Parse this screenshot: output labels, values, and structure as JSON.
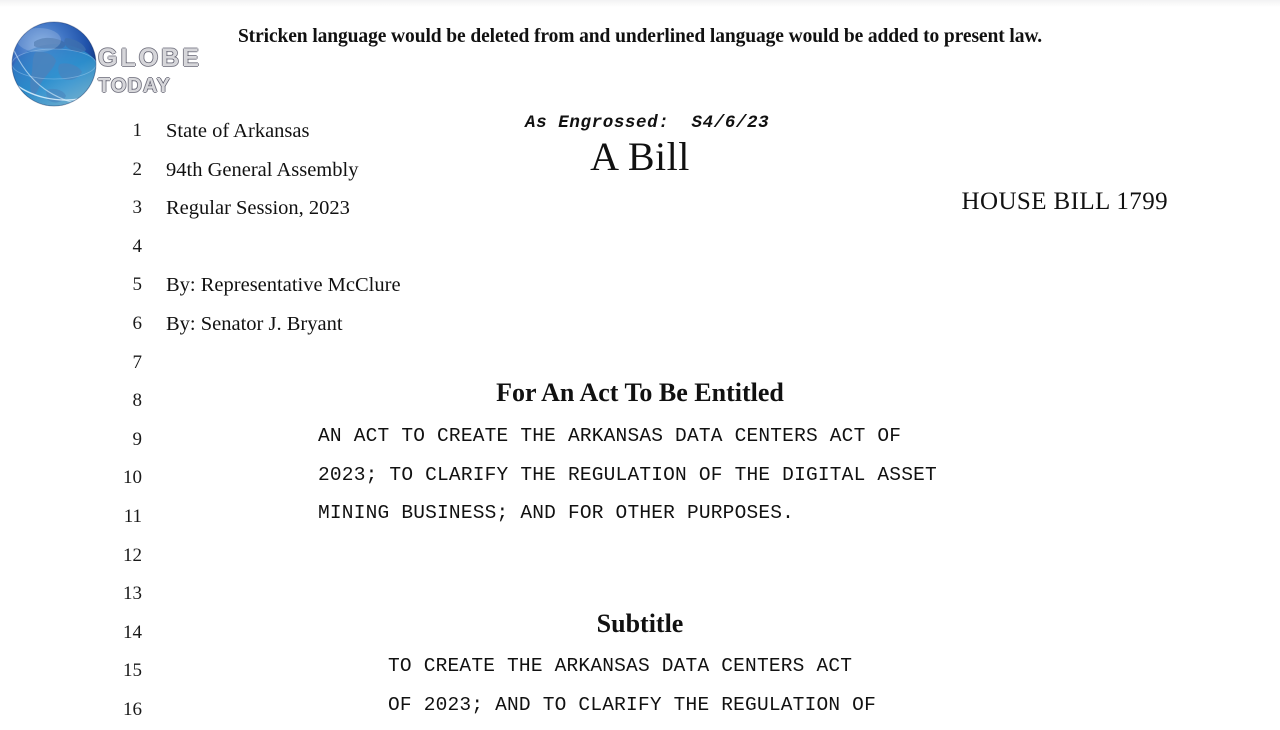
{
  "document": {
    "header_notice": "Stricken language would be deleted from and underlined language would be added to present law.",
    "as_engrossed": "As Engrossed:  S4/6/23",
    "bill_title": "A Bill",
    "bill_number": "HOUSE BILL 1799",
    "for_an_act_heading": "For An Act To Be Entitled",
    "subtitle_heading": "Subtitle",
    "line_numbers": [
      "1",
      "2",
      "3",
      "4",
      "5",
      "6",
      "7",
      "8",
      "9",
      "10",
      "11",
      "12",
      "13",
      "14",
      "15",
      "16"
    ],
    "left_column_lines": [
      "State of Arkansas",
      "94th General Assembly",
      "Regular Session, 2023",
      "",
      "By: Representative McClure",
      "By: Senator J. Bryant"
    ],
    "act_title_lines": [
      "AN ACT TO CREATE THE ARKANSAS DATA CENTERS ACT OF",
      "2023; TO CLARIFY THE REGULATION OF THE DIGITAL ASSET",
      "MINING BUSINESS; AND FOR OTHER PURPOSES."
    ],
    "subtitle_lines": [
      "TO CREATE THE ARKANSAS DATA CENTERS ACT",
      "OF 2023; AND TO CLARIFY THE REGULATION OF"
    ]
  },
  "watermark": {
    "line1": "GLOBE",
    "line2": "TODAY",
    "icon": "globe-icon"
  },
  "colors": {
    "page_background": "#ffffff",
    "text": "#111111",
    "globe_blue_dark": "#1b3f8f",
    "globe_blue_mid": "#2f7fc4",
    "globe_blue_light": "#7fd2ef",
    "globe_land": "#3b6fae"
  }
}
